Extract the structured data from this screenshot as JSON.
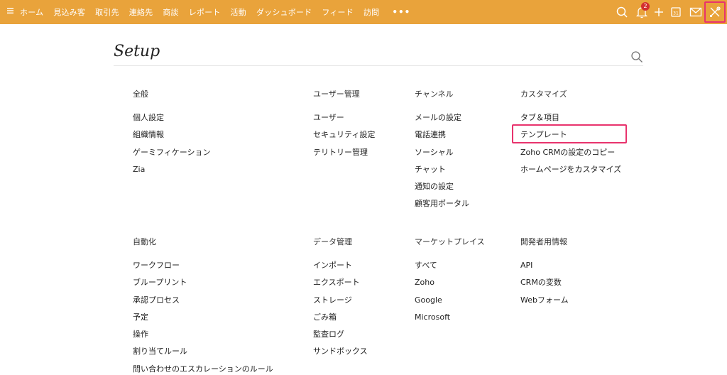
{
  "topbar": {
    "nav": [
      "ホーム",
      "見込み客",
      "取引先",
      "連絡先",
      "商談",
      "レポート",
      "活動",
      "ダッシュボード",
      "フィード",
      "訪問"
    ],
    "more": "•••",
    "notification_count": "2",
    "bg_color": "#e9a33b",
    "icons": [
      "menu-icon",
      "search-icon",
      "bell-icon",
      "plus-icon",
      "calendar-icon",
      "mail-icon",
      "setup-tools-icon"
    ]
  },
  "setup": {
    "title": "Setup"
  },
  "sections": {
    "general": {
      "title": "全般",
      "items": [
        "個人設定",
        "組織情報",
        "ゲーミフィケーション",
        "Zia"
      ]
    },
    "users": {
      "title": "ユーザー管理",
      "items": [
        "ユーザー",
        "セキュリティ設定",
        "テリトリー管理"
      ]
    },
    "channels": {
      "title": "チャンネル",
      "items": [
        "メールの設定",
        "電話連携",
        "ソーシャル",
        "チャット",
        "通知の設定",
        "顧客用ポータル"
      ]
    },
    "customize": {
      "title": "カスタマイズ",
      "items": [
        "タブ＆項目",
        "テンプレート",
        "Zoho CRMの設定のコピー",
        "ホームページをカスタマイズ"
      ]
    },
    "automation": {
      "title": "自動化",
      "items": [
        "ワークフロー",
        "ブループリント",
        "承認プロセス",
        "予定",
        "操作",
        "割り当てルール",
        "問い合わせのエスカレーションのルール"
      ]
    },
    "data": {
      "title": "データ管理",
      "items": [
        "インポート",
        "エクスポート",
        "ストレージ",
        "ごみ箱",
        "監査ログ",
        "サンドボックス"
      ]
    },
    "marketplace": {
      "title": "マーケットプレイス",
      "items": [
        "すべて",
        "Zoho",
        "Google",
        "Microsoft"
      ]
    },
    "developer": {
      "title": "開発者用情報",
      "items": [
        "API",
        "CRMの変数",
        "Webフォーム"
      ]
    }
  },
  "highlight_color": "#e8336d"
}
